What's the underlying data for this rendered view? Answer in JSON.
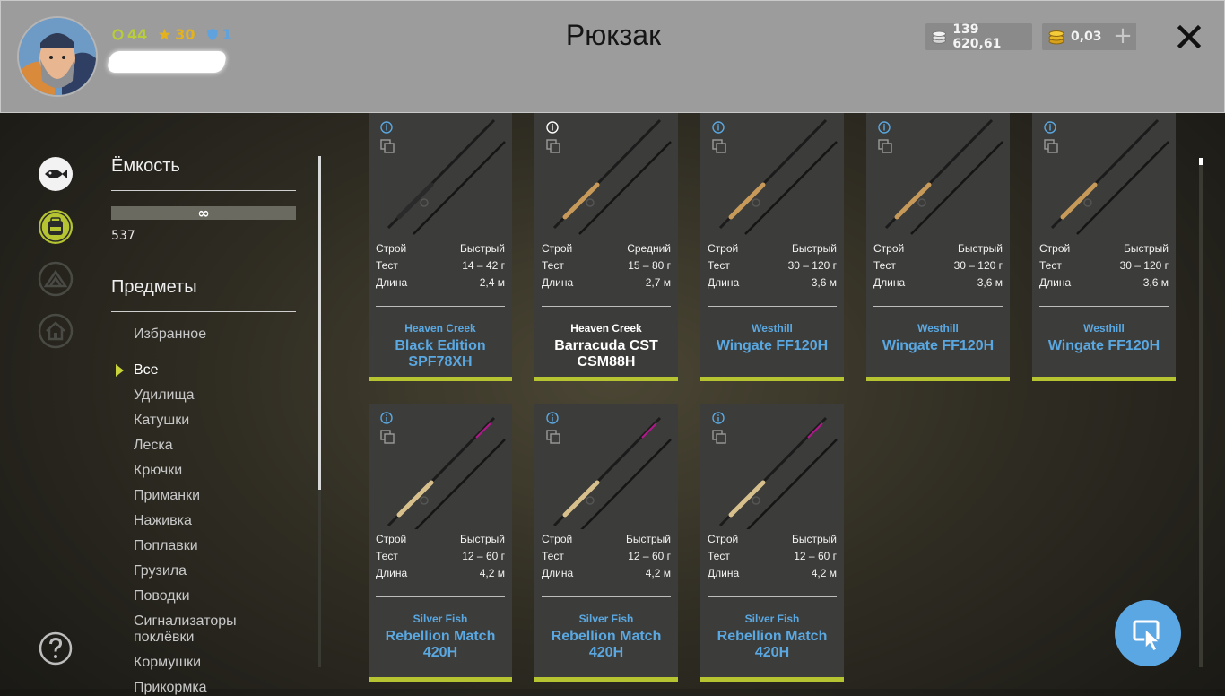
{
  "header": {
    "title": "Рюкзак",
    "player": {
      "level": "44",
      "rank": "30",
      "shield": "1"
    },
    "currency": {
      "silver": "139 620,61",
      "gold": "0,03",
      "add_label": "+"
    },
    "close_icon": "close-icon"
  },
  "sidebar": {
    "capacity_title": "Ёмкость",
    "capacity_symbol": "∞",
    "capacity_count": "537",
    "items_title": "Предметы",
    "categories": [
      {
        "label": "Избранное"
      },
      {
        "label": "Все",
        "active": true
      },
      {
        "label": "Удилища"
      },
      {
        "label": "Катушки"
      },
      {
        "label": "Леска"
      },
      {
        "label": "Крючки"
      },
      {
        "label": "Приманки"
      },
      {
        "label": "Наживка"
      },
      {
        "label": "Поплавки"
      },
      {
        "label": "Грузила"
      },
      {
        "label": "Поводки"
      },
      {
        "label": "Сигнализаторы поклёвки"
      },
      {
        "label": "Кормушки"
      },
      {
        "label": "Прикормка"
      }
    ]
  },
  "rail_icons": [
    "fish-icon",
    "backpack-icon",
    "tent-icon",
    "home-icon"
  ],
  "items": [
    {
      "brand": "Heaven Creek",
      "model": "Black Edition SPF78XH",
      "action_label": "Строй",
      "action": "Быстрый",
      "test_label": "Тест",
      "test": "14 – 42 г",
      "length_label": "Длина",
      "length": "2,4 м"
    },
    {
      "brand": "Heaven Creek",
      "model": "Barracuda CST CSM88H",
      "action_label": "Строй",
      "action": "Средний",
      "test_label": "Тест",
      "test": "15 – 80 г",
      "length_label": "Длина",
      "length": "2,7 м"
    },
    {
      "brand": "Westhill",
      "model": "Wingate FF120H",
      "action_label": "Строй",
      "action": "Быстрый",
      "test_label": "Тест",
      "test": "30 – 120 г",
      "length_label": "Длина",
      "length": "3,6 м"
    },
    {
      "brand": "Westhill",
      "model": "Wingate FF120H",
      "action_label": "Строй",
      "action": "Быстрый",
      "test_label": "Тест",
      "test": "30 – 120 г",
      "length_label": "Длина",
      "length": "3,6 м"
    },
    {
      "brand": "Westhill",
      "model": "Wingate FF120H",
      "action_label": "Строй",
      "action": "Быстрый",
      "test_label": "Тест",
      "test": "30 – 120 г",
      "length_label": "Длина",
      "length": "3,6 м"
    },
    {
      "brand": "Silver Fish",
      "model": "Rebellion Match 420H",
      "action_label": "Строй",
      "action": "Быстрый",
      "test_label": "Тест",
      "test": "12 – 60 г",
      "length_label": "Длина",
      "length": "4,2 м"
    },
    {
      "brand": "Silver Fish",
      "model": "Rebellion Match 420H",
      "action_label": "Строй",
      "action": "Быстрый",
      "test_label": "Тест",
      "test": "12 – 60 г",
      "length_label": "Длина",
      "length": "4,2 м"
    },
    {
      "brand": "Silver Fish",
      "model": "Rebellion Match 420H",
      "action_label": "Строй",
      "action": "Быстрый",
      "test_label": "Тест",
      "test": "12 – 60 г",
      "length_label": "Длина",
      "length": "4,2 м"
    }
  ],
  "colors": {
    "accent_green": "#b5c430",
    "brand_blue": "#5aa8e2",
    "header_grey": "#9c9c9c"
  }
}
